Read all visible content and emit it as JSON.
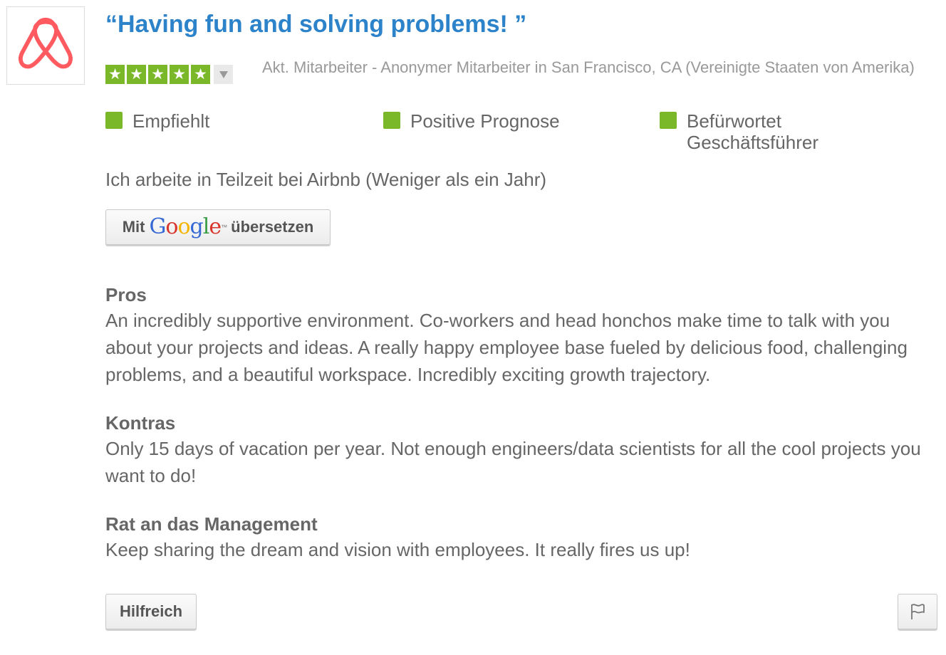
{
  "review": {
    "title": "“Having fun and solving problems! ”",
    "rating": 5,
    "rating_max": 5,
    "author": "Akt. Mitarbeiter - Anonymer Mitarbeiter in San Francisco, CA (Vereinigte Staaten von Amerika)",
    "badges": [
      "Empfiehlt",
      "Positive Prognose",
      "Befürwortet Geschäftsführer"
    ],
    "employment": "Ich arbeite in Teilzeit bei Airbnb (Weniger als ein Jahr)",
    "pros_title": "Pros",
    "pros_text": "An incredibly supportive environment. Co-workers and head honchos make time to talk with you about your projects and ideas. A really happy employee base fueled by delicious food, challenging problems, and a beautiful workspace. Incredibly exciting growth trajectory.",
    "cons_title": "Kontras",
    "cons_text": "Only 15 days of vacation per year. Not enough engineers/data scientists for all the cool projects you want to do!",
    "advice_title": "Rat an das Management",
    "advice_text": "Keep sharing the dream and vision with employees. It really fires us up!"
  },
  "translate": {
    "prefix": "Mit",
    "brand": "Google",
    "trademark": "™",
    "suffix": "übersetzen"
  },
  "actions": {
    "helpful_label": "Hilfreich"
  },
  "colors": {
    "accent": "#2d83c9",
    "star": "#7ab82a",
    "logo": "#ff5a5f",
    "text": "#666666",
    "muted": "#999999"
  },
  "icons": {
    "logo": "airbnb-logo-icon",
    "star": "star-icon",
    "dropdown": "caret-down-icon",
    "badge": "green-square-icon",
    "flag": "flag-icon"
  }
}
